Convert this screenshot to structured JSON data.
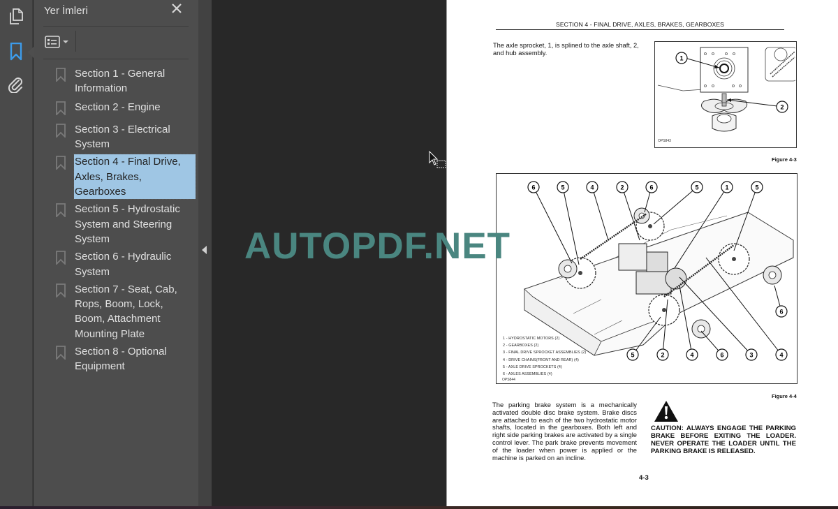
{
  "sidebar": {
    "rail_icons": [
      "pages-icon",
      "bookmark-icon",
      "attachment-icon"
    ],
    "panel_title": "Yer İmleri",
    "bookmarks": [
      {
        "label": "Section 1 - General Information",
        "selected": false
      },
      {
        "label": "Section 2 - Engine",
        "selected": false
      },
      {
        "label": "Section 3 - Electrical System",
        "selected": false
      },
      {
        "label": "Section 4 - Final Drive, Axles, Brakes, Gearboxes",
        "selected": true
      },
      {
        "label": "Section 5 - Hydrostatic System and Steering System",
        "selected": false
      },
      {
        "label": "Section 6 - Hydraulic System",
        "selected": false
      },
      {
        "label": "Section 7 - Seat, Cab, Rops, Boom, Lock, Boom, Attachment Mounting Plate",
        "selected": false
      },
      {
        "label": "Section 8 - Optional Equipment",
        "selected": false
      }
    ]
  },
  "page": {
    "header": "SECTION 4 - FINAL DRIVE, AXLES, BRAKES, GEARBOXES",
    "para1": "The axle sprocket, 1, is splined to the axle shaft, 2, and hub assembly.",
    "figure3": {
      "caption": "Figure 4-3",
      "code": "OPS843",
      "callouts": [
        "1",
        "2"
      ]
    },
    "figure4": {
      "caption": "Figure 4-4",
      "code": "OPS844",
      "top_callouts": [
        "6",
        "5",
        "4",
        "2",
        "6",
        "5",
        "1",
        "5"
      ],
      "bottom_callouts": [
        "5",
        "2",
        "4",
        "6",
        "3",
        "4"
      ],
      "right_callout": "6",
      "legend": [
        "1 - HYDROSTATIC MOTORS (2)",
        "2 - GEARBOXES (2)",
        "3 - FINAL DRIVE SPROCKET ASSEMBLIES (2)",
        "4 - DRIVE CHAINS(FRONT AND REAR) (4)",
        "5 - AXLE DRIVE SPROCKETS (4)",
        "6 - AXLES ASSEMBLIES (4)"
      ]
    },
    "para2": "The parking brake system is a mechanically activated double disc brake system. Brake discs are attached to each of the two hydrostatic motor shafts, located in the gearboxes. Both left and right side parking brakes are activated by a single control lever. The park brake prevents movement of the loader when power is applied or the machine is parked on an incline.",
    "caution": "CAUTION: ALWAYS ENGAGE THE PARKING BRAKE BEFORE EXITING THE LOADER. NEVER OPERATE THE LOADER UNTIL THE PARKING BRAKE IS RELEASED.",
    "page_number": "4-3"
  },
  "watermark": "AUTOPDF.NET",
  "colors": {
    "accent_bookmark": "#3d9be9",
    "selection": "#9fc6e4",
    "watermark": "#4a8680"
  }
}
